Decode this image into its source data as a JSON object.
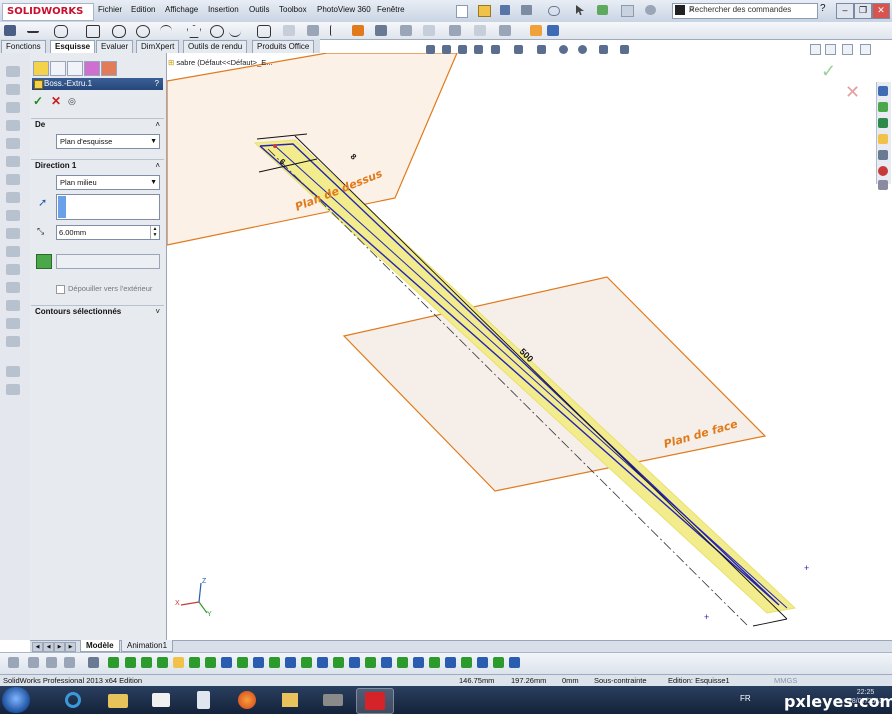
{
  "app": {
    "brand": "SOLIDWORKS",
    "menus": [
      "Fichier",
      "Edition",
      "Affichage",
      "Insertion",
      "Outils",
      "Toolbox",
      "PhotoView 360",
      "Fenêtre"
    ],
    "search_placeholder": "Rechercher des commandes",
    "help_glyph": "?"
  },
  "command_tabs": [
    "Fonctions",
    "Esquisse",
    "Evaluer",
    "DimXpert",
    "Outils de rendu",
    "Produits Office"
  ],
  "active_command_tab": "Esquisse",
  "property_manager": {
    "title": "Boss.-Extru.1",
    "help": "?",
    "from_section": {
      "label": "De",
      "value": "Plan d'esquisse"
    },
    "direction1": {
      "label": "Direction 1",
      "end_condition": "Plan milieu",
      "depth": "6.00mm",
      "draft_outward_label": "Dépouiller vers l'extérieur"
    },
    "selected_contours": {
      "label": "Contours sélectionnés"
    }
  },
  "tree": {
    "root": "sabre  (Défaut<<Défaut>_E..."
  },
  "viewport": {
    "plane_top": "Plan de dessus",
    "plane_front": "Plan de face",
    "dim_small_1": "8",
    "dim_small_2": "6",
    "dim_long": "500",
    "triad": {
      "x": "X",
      "y": "Y",
      "z": "Z"
    }
  },
  "bottom_tabs": [
    "Modèle",
    "Animation1"
  ],
  "active_bottom_tab": "Modèle",
  "status": {
    "product": "SolidWorks Professional 2013 x64 Edition",
    "x": "146.75mm",
    "y": "197.26mm",
    "z": "0mm",
    "constraint": "Sous-contrainte",
    "edit": "Edition: Esquisse1",
    "units": "MMGS"
  },
  "taskbar": {
    "lang": "FR",
    "time": "22:25",
    "date": "18/07/2013",
    "watermark": "pxleyes.com"
  },
  "colors": {
    "plane": "#e07a1c",
    "sketch": "#2323b8",
    "highlight": "#f2ec8c",
    "title_bar": "#2f568d"
  }
}
